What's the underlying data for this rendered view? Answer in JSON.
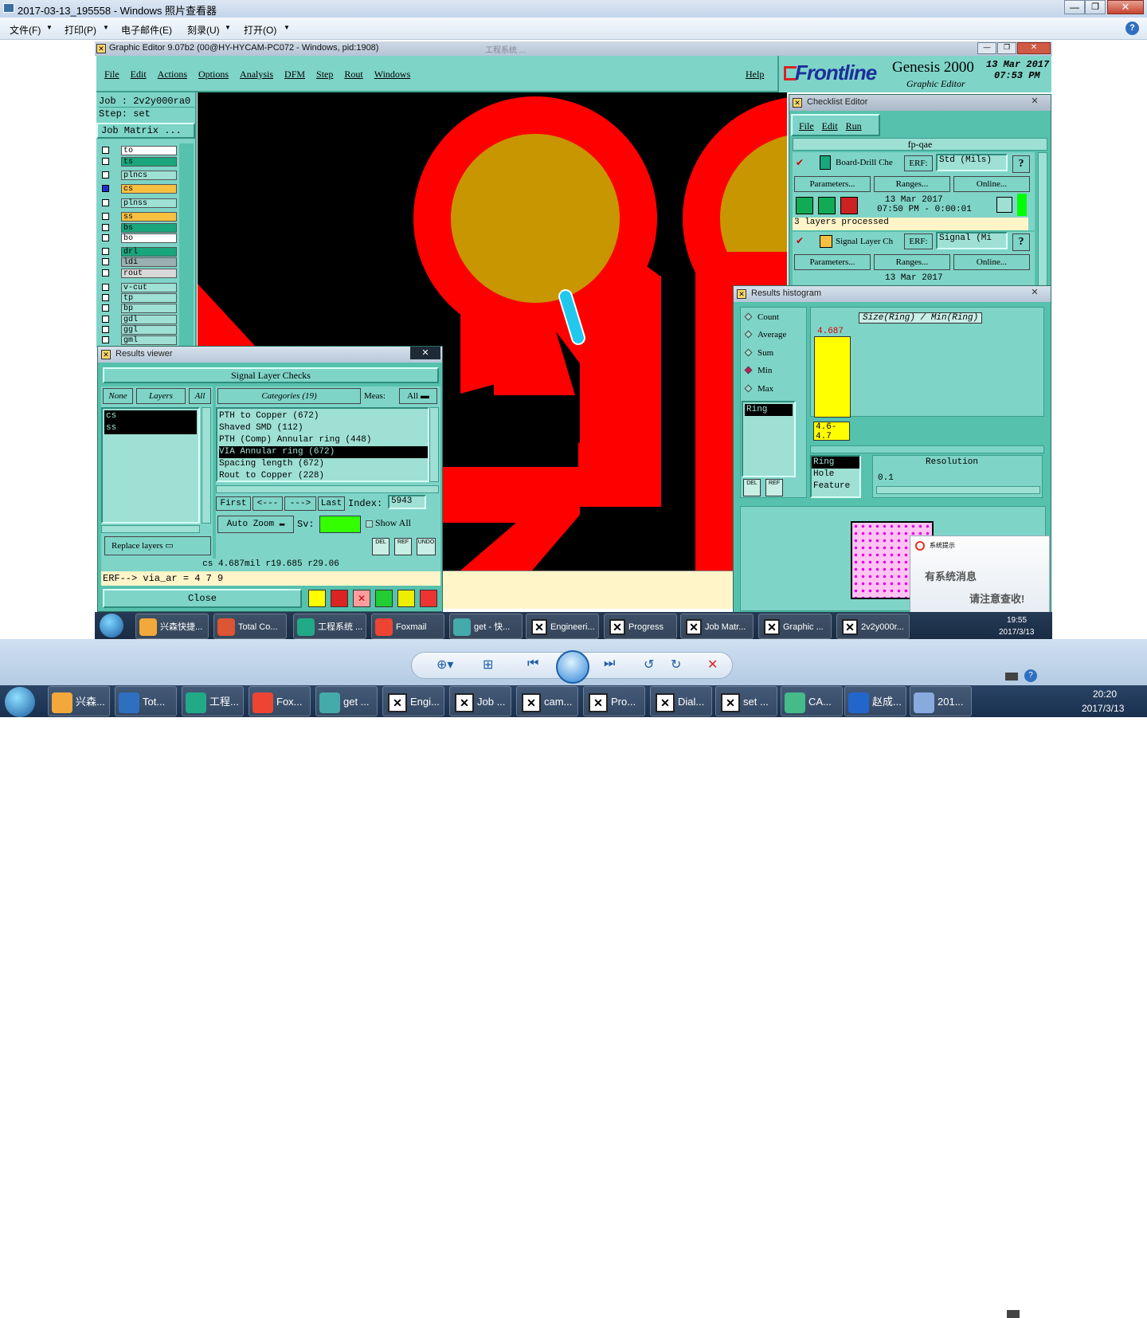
{
  "viewer": {
    "title": "2017-03-13_195558 - Windows 照片查看器",
    "menu": [
      "文件(F)",
      "打印(P)",
      "电子邮件(E)",
      "刻录(U)",
      "打开(O)"
    ],
    "help_icon": "?"
  },
  "genesis": {
    "title": "Graphic Editor 9.07b2 (00@HY-HYCAM-PC072 - Windows, pid:1908)",
    "ghost_title": "工程系统 ...",
    "menu": [
      "File",
      "Edit",
      "Actions",
      "Options",
      "Analysis",
      "DFM",
      "Step",
      "Rout",
      "Windows"
    ],
    "help": "Help",
    "brand": "Frontline",
    "product": "Genesis 2000",
    "subtitle": "Graphic Editor",
    "date": "13 Mar 2017",
    "time": "07:53 PM",
    "job_label": "Job : 2v2y000ra0",
    "step_label": "Step: set",
    "job_matrix": "Job Matrix ...",
    "layers": [
      "to",
      "ts",
      "plncs",
      "cs",
      "plnss",
      "ss",
      "bs",
      "bo",
      "drl",
      "ldi",
      "rout",
      "v-cut",
      "tp",
      "bp",
      "gdl",
      "ggl",
      "gml"
    ],
    "layer_colors": [
      "#ffffff",
      "#1aa67c",
      "#9ee0d4",
      "#f8c040",
      "#9ee0d4",
      "#f8c040",
      "#1aa67c",
      "#ffffff",
      "#1aa67c",
      "#9ab0b0",
      "#d8d8d8",
      "#9ee0d4",
      "#9ee0d4",
      "#9ee0d4",
      "#9ee0d4",
      "#9ee0d4",
      "#9ee0d4"
    ]
  },
  "results_viewer": {
    "title": "Results viewer",
    "header": "Signal Layer Checks",
    "none": "None",
    "layers": "Layers",
    "all": "All",
    "categories": "Categories (19)",
    "meas_label": "Meas:",
    "meas_value": "All",
    "layer_list": [
      "cs",
      "ss"
    ],
    "category_list": [
      "PTH to Copper (672)",
      "Shaved SMD (112)",
      "PTH (Comp) Annular ring (448)",
      "VIA Annular ring (672)",
      "Spacing length (672)",
      "Rout to Copper (228)"
    ],
    "nav": [
      "First",
      "<---",
      "--->",
      "Last"
    ],
    "index_label": "Index:",
    "index_value": "5943",
    "auto_zoom": "Auto Zoom",
    "sv_label": "Sv:",
    "show_all": "Show All",
    "replace_layers": "Replace layers",
    "status": "cs 4.687mil r19.685 r29.06",
    "erf": "ERF--> via_ar = 4 7 9",
    "close": "Close",
    "dlg_icons": [
      "DEL",
      "REF",
      "UNDO"
    ]
  },
  "checklist": {
    "title": "Checklist Editor",
    "menu": [
      "File",
      "Edit",
      "Run"
    ],
    "name": "fp-qae",
    "items": [
      {
        "name": "Board-Drill Che",
        "erf": "ERF:",
        "erf_val": "Std (Mils)",
        "params": "Parameters...",
        "ranges": "Ranges...",
        "online": "Online...",
        "date": "13 Mar 2017",
        "time": "07:50 PM - 0:00:01",
        "status": "3 layers processed"
      },
      {
        "name": "Signal Layer Ch",
        "erf": "ERF:",
        "erf_val": "Signal (Mi",
        "params": "Parameters...",
        "ranges": "Ranges...",
        "online": "Online...",
        "date": "13 Mar 2017"
      }
    ]
  },
  "histogram": {
    "title": "Results histogram",
    "options": [
      "Count",
      "Average",
      "Sum",
      "Min",
      "Max"
    ],
    "selected": "Min",
    "chart_title": "Size(Ring) / Min(Ring)",
    "bar_value": "4.687",
    "bar_range": "4.6-4.7",
    "attr_list": [
      "Ring"
    ],
    "feature_list": [
      "Ring",
      "Hole",
      "Feature"
    ],
    "resolution_label": "Resolution",
    "resolution_value": "0.1",
    "icons": [
      "DEL",
      "REF"
    ]
  },
  "notify": {
    "header": "系统提示",
    "line1": "有系统消息",
    "line2": "请注意查收!"
  },
  "inner_taskbar": {
    "items": [
      "兴森快捷...",
      "Total Co...",
      "工程系统 ...",
      "Foxmail",
      "get - 快...",
      "Engineeri...",
      "Progress",
      "Job Matr...",
      "Graphic ...",
      "2v2y000r..."
    ],
    "time": "19:55",
    "date": "2017/3/13"
  },
  "outer_taskbar": {
    "items": [
      "兴森...",
      "Tot...",
      "工程...",
      "Fox...",
      "get ...",
      "Engi...",
      "Job ...",
      "cam...",
      "Pro...",
      "Dial...",
      "set ...",
      "CA...",
      "赵成...",
      "201..."
    ],
    "time": "20:20",
    "date": "2017/3/13"
  }
}
